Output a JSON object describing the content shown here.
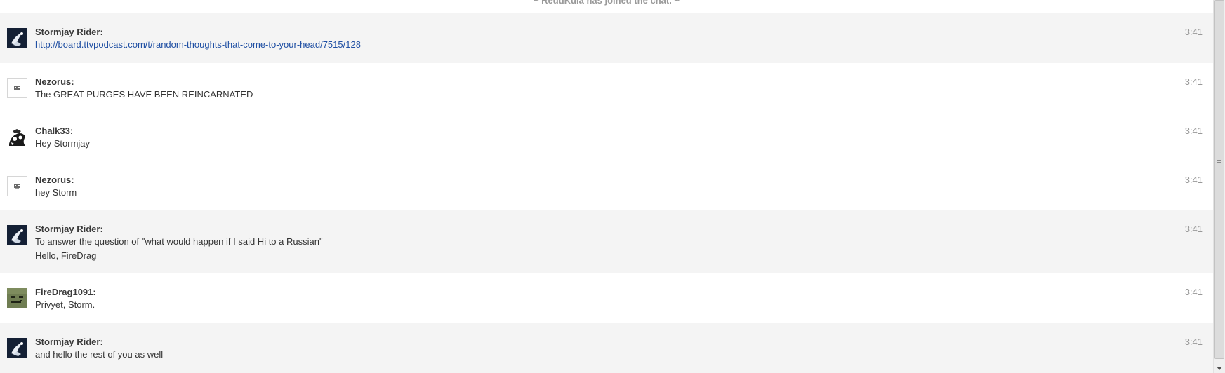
{
  "system_message": "~ ReddKula has joined the chat. ~",
  "messages": [
    {
      "user": "Stormjay Rider:",
      "time": "3:41",
      "lines": [
        "http://board.ttvpodcast.com/t/random-thoughts-that-come-to-your-head/7515/128"
      ],
      "avatar_icon": "dark-avatar-icon"
    },
    {
      "user": "Nezorus:",
      "time": "3:41",
      "lines": [
        "The GREAT PURGES HAVE BEEN REINCARNATED"
      ],
      "avatar_icon": "small-logo-avatar-icon"
    },
    {
      "user": "Chalk33:",
      "time": "3:41",
      "lines": [
        "Hey Stormjay"
      ],
      "avatar_icon": "sketch-avatar-icon"
    },
    {
      "user": "Nezorus:",
      "time": "3:41",
      "lines": [
        "hey Storm"
      ],
      "avatar_icon": "small-logo-avatar-icon"
    },
    {
      "user": "Stormjay Rider:",
      "time": "3:41",
      "lines": [
        "To answer the question of \"what would happen if I said Hi to a Russian\"",
        "Hello, FireDrag"
      ],
      "avatar_icon": "dark-avatar-icon"
    },
    {
      "user": "FireDrag1091:",
      "time": "3:41",
      "lines": [
        "Privyet, Storm."
      ],
      "avatar_icon": "green-face-avatar-icon"
    },
    {
      "user": "Stormjay Rider:",
      "time": "3:41",
      "lines": [
        "and hello the rest of you as well"
      ],
      "avatar_icon": "dark-avatar-icon"
    }
  ],
  "colors": {
    "shaded_row": "#f4f4f4",
    "link": "#1f4fa3",
    "timestamp": "#999999",
    "system_message": "#9a9a9a"
  }
}
